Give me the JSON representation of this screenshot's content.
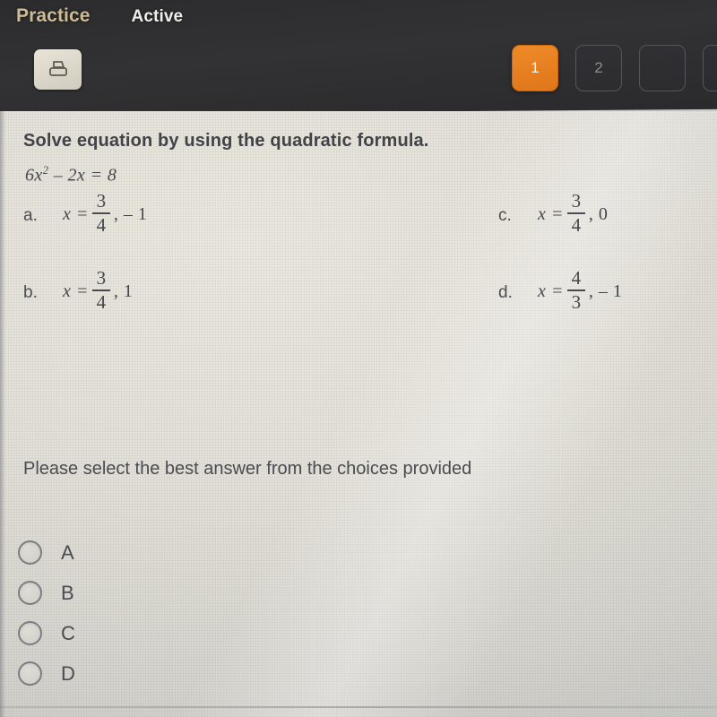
{
  "header": {
    "tabs": [
      {
        "label": "Practice",
        "state": "selected",
        "color": "#cdbb96"
      },
      {
        "label": "Active",
        "state": "normal",
        "color": "#eeeeea"
      }
    ],
    "print_button": {
      "icon": "printer-icon",
      "label": ""
    },
    "pager": [
      {
        "label": "1",
        "selected": true
      },
      {
        "label": "2",
        "selected": false
      },
      {
        "label": "",
        "selected": false
      },
      {
        "label": "",
        "selected": false
      }
    ],
    "accent_color": "#e8821e",
    "background_color": "#2f2f31"
  },
  "question": {
    "title": "Solve equation by using the quadratic formula.",
    "equation": {
      "lhs_coeff": "6",
      "var": "x",
      "exponent": "2",
      "middle": "– 2x",
      "equals": "=",
      "rhs": "8"
    },
    "equation_text": "6x² – 2x = 8",
    "options": [
      {
        "letter": "a.",
        "lead": "x =",
        "numerator": "3",
        "denominator": "4",
        "tail": ", – 1",
        "text": "x = 3/4, – 1"
      },
      {
        "letter": "b.",
        "lead": "x =",
        "numerator": "3",
        "denominator": "4",
        "tail": ", 1",
        "text": "x = 3/4, 1"
      },
      {
        "letter": "c.",
        "lead": "x =",
        "numerator": "3",
        "denominator": "4",
        "tail": ", 0",
        "text": "x = 3/4, 0"
      },
      {
        "letter": "d.",
        "lead": "x =",
        "numerator": "4",
        "denominator": "3",
        "tail": ", – 1",
        "text": "x = 4/3, – 1"
      }
    ]
  },
  "instruction": "Please select the best answer from the choices provided",
  "answer_choices": [
    {
      "label": "A",
      "selected": false
    },
    {
      "label": "B",
      "selected": false
    },
    {
      "label": "C",
      "selected": false
    },
    {
      "label": "D",
      "selected": false
    }
  ]
}
